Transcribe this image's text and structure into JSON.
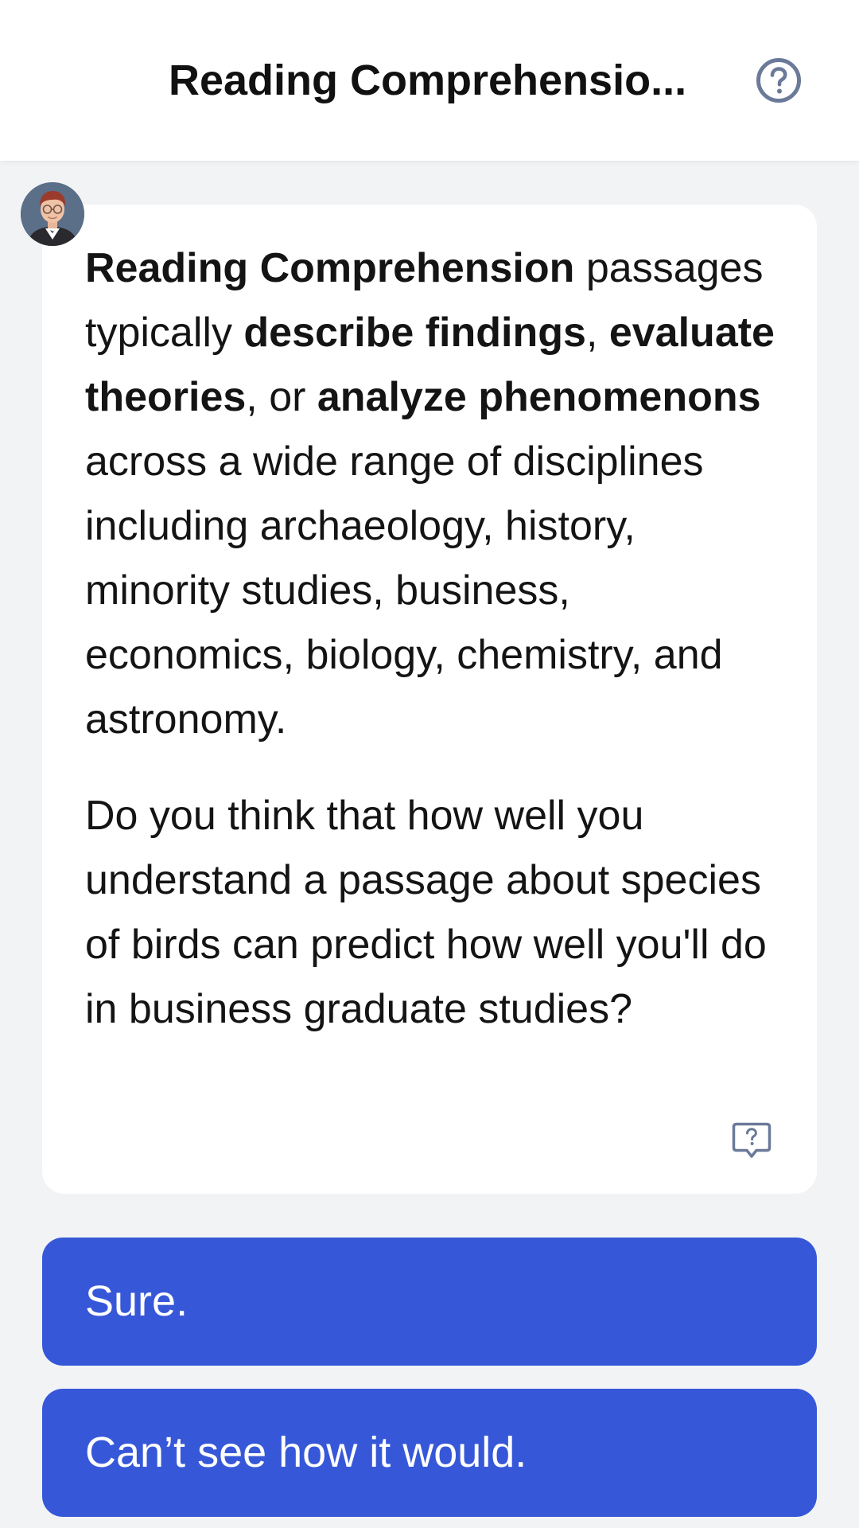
{
  "header": {
    "title": "Reading Comprehensio...",
    "help_icon": "question-circle-icon"
  },
  "message": {
    "avatar": "tutor-avatar",
    "paragraph1": {
      "part1_bold": "Reading Comprehension",
      "part2": " passages typically ",
      "part3_bold": "describe findings",
      "part4": ", ",
      "part5_bold": "evaluate theories",
      "part6": ", or ",
      "part7_bold": "analyze phenomenons",
      "part8": " across a wide range of disciplines including archaeology, history, minority studies, business, economics, biology, chemistry, and astronomy."
    },
    "paragraph2": "Do you think that how well you understand a passage about species of birds can predict how well you'll do in business graduate studies?",
    "report_icon": "question-bubble-icon"
  },
  "answers": [
    {
      "label": "Sure."
    },
    {
      "label": "Can’t see how it would."
    }
  ],
  "colors": {
    "accent": "#3658d8",
    "background": "#f2f3f5",
    "card": "#ffffff",
    "icon": "#6b7a99"
  }
}
